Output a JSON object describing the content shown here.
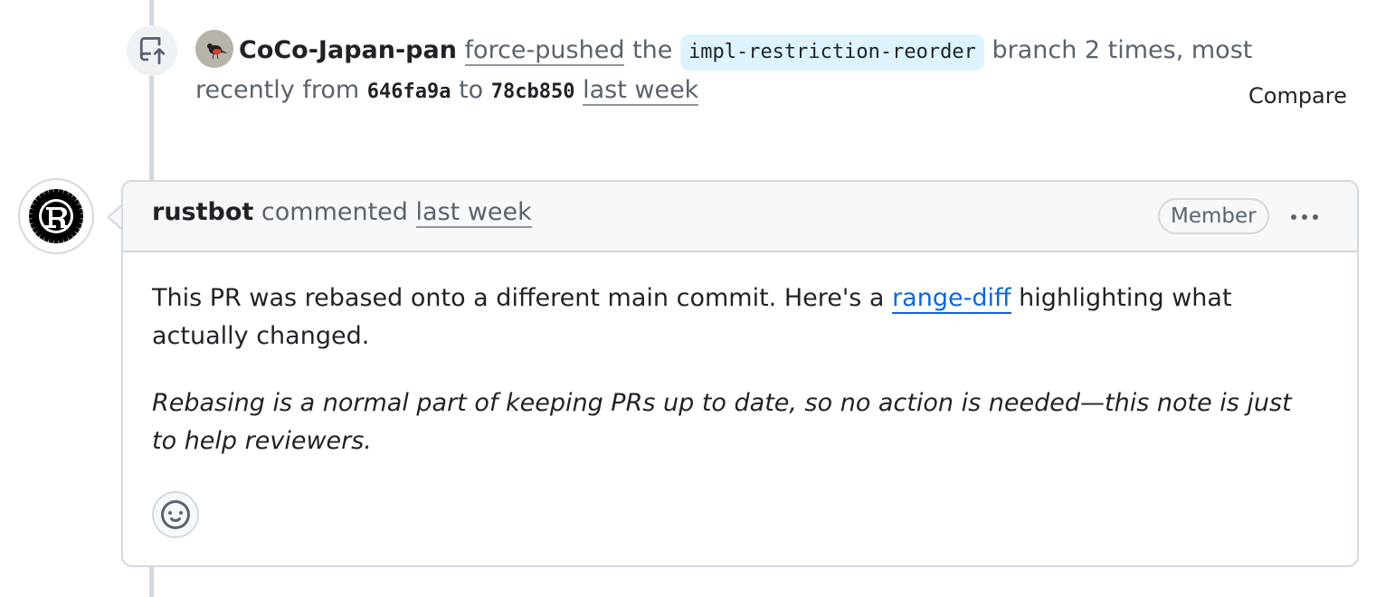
{
  "colors": {
    "link": "#0969da",
    "muted_text": "#59636e",
    "border": "#d1d9e0",
    "branch_bg": "#ddf4ff",
    "header_bg": "#f6f8fa"
  },
  "push_event": {
    "icon": "repo-push-icon",
    "actor": "CoCo-Japan-pan",
    "action_link": "force-pushed",
    "text_the": "the",
    "branch": "impl-restriction-reorder",
    "text_branch_times": "branch 2 times, most recently from",
    "from_sha": "646fa9a",
    "text_to": "to",
    "to_sha": "78cb850",
    "time": "last week",
    "compare_label": "Compare"
  },
  "comment": {
    "author": "rustbot",
    "action": "commented",
    "time": "last week",
    "role_badge": "Member",
    "body_p1_before_link": "This PR was rebased onto a different main commit. Here's a",
    "body_p1_link": "range-diff",
    "body_p1_after_link": "highlighting what actually changed.",
    "body_p2": "Rebasing is a normal part of keeping PRs up to date, so no action is needed—this note is just to help reviewers.",
    "reaction_icon": "smiley-icon"
  }
}
